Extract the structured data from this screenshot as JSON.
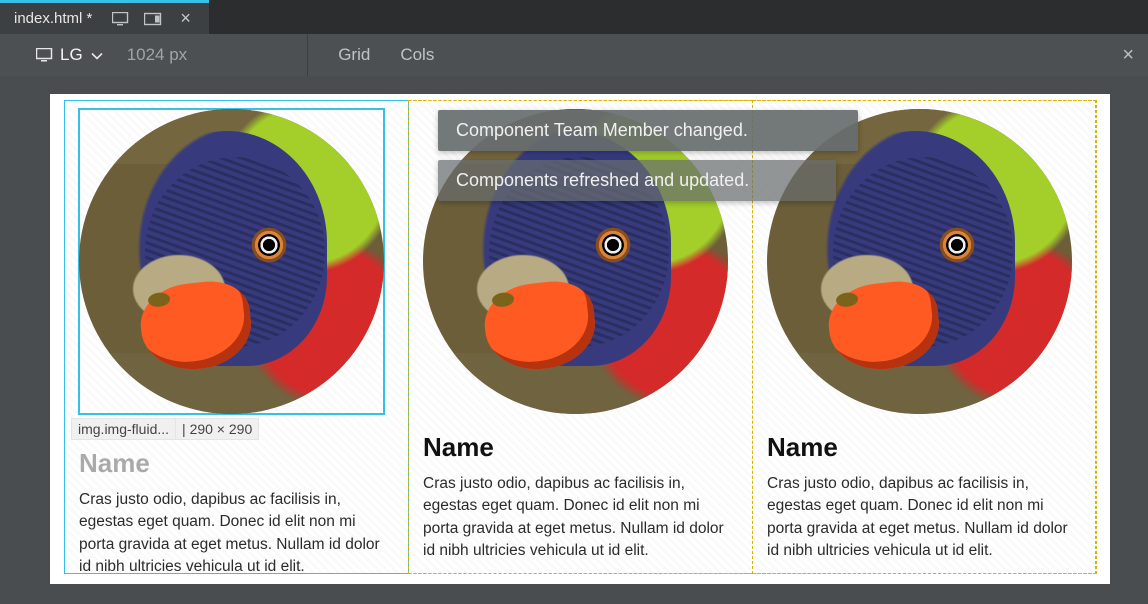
{
  "tab": {
    "filename": "index.html *",
    "close_glyph": "×"
  },
  "toolbar": {
    "breakpoint_label": "LG",
    "width_label": "1024 px",
    "grid_label": "Grid",
    "cols_label": "Cols",
    "close_glyph": "×"
  },
  "notifications": [
    "Component Team Member changed.",
    "Components refreshed and updated."
  ],
  "selection": {
    "element_label": "img.img-fluid...",
    "separator": " | ",
    "dimensions": "290 × 290"
  },
  "cards": [
    {
      "heading": "Name",
      "body": "Cras justo odio, dapibus ac facilisis in, egestas eget quam. Donec id elit non mi porta gravida at eget metus. Nullam id dolor id nibh ultricies vehicula ut id elit."
    },
    {
      "heading": "Name",
      "body": "Cras justo odio, dapibus ac facilisis in, egestas eget quam. Donec id elit non mi porta gravida at eget metus. Nullam id dolor id nibh ultricies vehicula ut id elit."
    },
    {
      "heading": "Name",
      "body": "Cras justo odio, dapibus ac facilisis in, egestas eget quam. Donec id elit non mi porta gravida at eget metus. Nullam id dolor id nibh ultricies vehicula ut id elit."
    }
  ]
}
